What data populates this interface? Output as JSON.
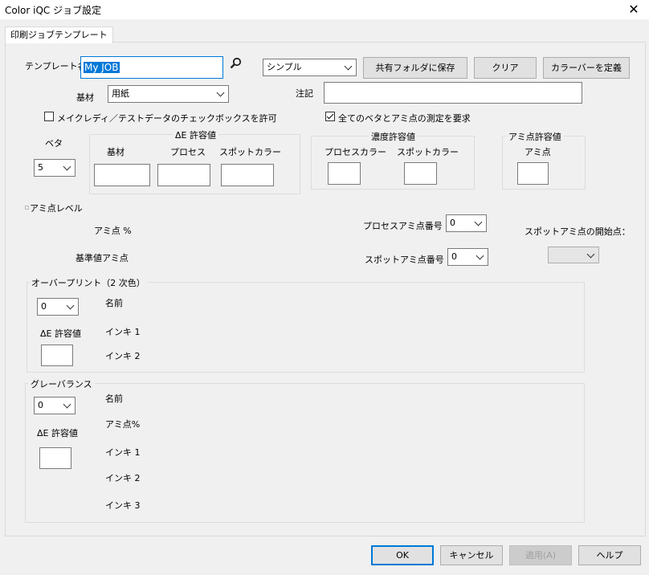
{
  "window": {
    "title": "Color iQC ジョブ設定",
    "close_glyph": "✕"
  },
  "tab": {
    "label": "印刷ジョブテンプレート"
  },
  "template": {
    "name_label": "テンプレート名",
    "name_value": "My JOB",
    "mode_value": "シンプル",
    "save_shared_button": "共有フォルダに保存",
    "clear_button": "クリア",
    "define_colorbar_button": "カラーバーを定義"
  },
  "substrate": {
    "label": "基材",
    "value": "用紙"
  },
  "note": {
    "label": "注記",
    "value": ""
  },
  "checks": {
    "makeready_label": "メイクレディ／テストデータのチェックボックスを許可",
    "makeready_checked": false,
    "all_patches_label": "全てのベタとアミ点の測定を要求",
    "all_patches_checked": true
  },
  "solid": {
    "label": "ベタ",
    "value": "5"
  },
  "delta_e": {
    "legend": "ΔE 許容値",
    "substrate": "基材",
    "process": "プロセス",
    "spot": "スポットカラー"
  },
  "density": {
    "legend": "濃度許容値",
    "process": "プロセスカラー",
    "spot": "スポットカラー"
  },
  "halftone_tol": {
    "legend": "アミ点許容値",
    "dot": "アミ点"
  },
  "halftone_level": {
    "label": "アミ点レベル",
    "dot_percent": "アミ点 %",
    "reference_dot": "基準値アミ点",
    "process_dot_number_label": "プロセスアミ点番号",
    "process_dot_number_value": "0",
    "spot_dot_number_label": "スポットアミ点番号",
    "spot_dot_number_value": "0",
    "spot_dot_start_label": "スポットアミ点の開始点：",
    "spot_dot_start_value": ""
  },
  "overprint": {
    "legend": "オーバープリント（2 次色）",
    "count_value": "0",
    "delta_e_label": "ΔE 許容値",
    "name": "名前",
    "ink1": "インキ 1",
    "ink2": "インキ 2"
  },
  "gray_balance": {
    "legend": "グレーバランス",
    "count_value": "0",
    "delta_e_label": "ΔE 許容値",
    "name": "名前",
    "dot_percent": "アミ点%",
    "ink1": "インキ 1",
    "ink2": "インキ 2",
    "ink3": "インキ 3"
  },
  "footer": {
    "ok": "OK",
    "cancel": "キャンセル",
    "apply": "適用(A)",
    "help": "ヘルプ"
  }
}
